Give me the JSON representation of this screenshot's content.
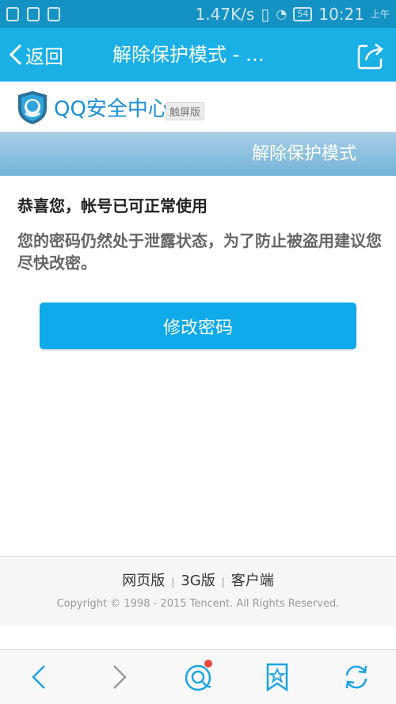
{
  "status_bar": {
    "speed": "1.47K/s",
    "battery": "54",
    "time": "10:21",
    "ampm": "上午"
  },
  "nav": {
    "back_label": "返回",
    "title": "解除保护模式 - …"
  },
  "brand": {
    "name": "QQ安全中心",
    "badge": "触屏版"
  },
  "section": {
    "title": "解除保护模式"
  },
  "content": {
    "headline": "恭喜您，帐号已可正常使用",
    "description": "您的密码仍然处于泄露状态，为了防止被盗用建议您尽快改密。",
    "button_label": "修改密码"
  },
  "footer": {
    "links": [
      "网页版",
      "3G版",
      "客户端"
    ],
    "copyright": "Copyright © 1998 - 2015 Tencent. All Rights Reserved."
  },
  "colors": {
    "nav_bg": "#1ab0e6",
    "status_bg": "#1592c4",
    "button_bg": "#0eaae9",
    "brand_text": "#1a8fd6",
    "notify_dot": "#e84a3c"
  },
  "icons": {
    "back": "chevron-left-icon",
    "share": "share-icon",
    "prev": "arrow-left-icon",
    "next": "arrow-right-icon",
    "home": "qq-home-icon",
    "bookmark": "bookmark-star-icon",
    "refresh": "refresh-icon"
  }
}
